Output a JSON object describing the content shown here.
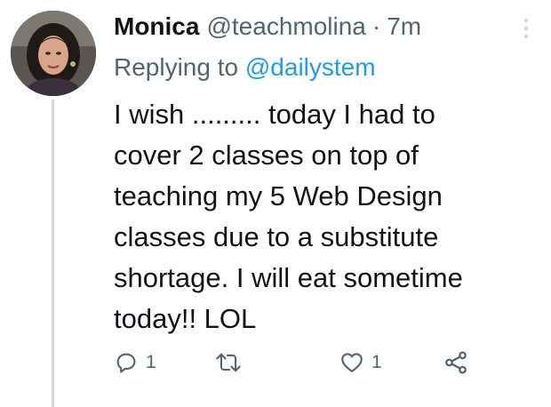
{
  "author": {
    "display_name": "Monica",
    "handle": "@teachmolina",
    "separator": "·",
    "timestamp": "7m",
    "avatar": "profile-photo"
  },
  "reply": {
    "prefix": "Replying to",
    "mention": "@dailystem"
  },
  "tweet": {
    "lines": [
      "I wish ......... today I had to",
      "cover 2 classes on top of",
      "teaching my 5 Web Design",
      "classes due to a substitute",
      "shortage. I will eat sometime",
      "today!! LOL"
    ]
  },
  "actions": {
    "reply": {
      "icon": "reply-icon",
      "count": "1"
    },
    "retweet": {
      "icon": "retweet-icon",
      "count": ""
    },
    "like": {
      "icon": "heart-icon",
      "count": "1"
    },
    "share": {
      "icon": "share-icon"
    }
  },
  "colors": {
    "text": "#0f1419",
    "secondary": "#536471",
    "link": "#1d9bf0",
    "thread_line": "#cfd9de"
  }
}
